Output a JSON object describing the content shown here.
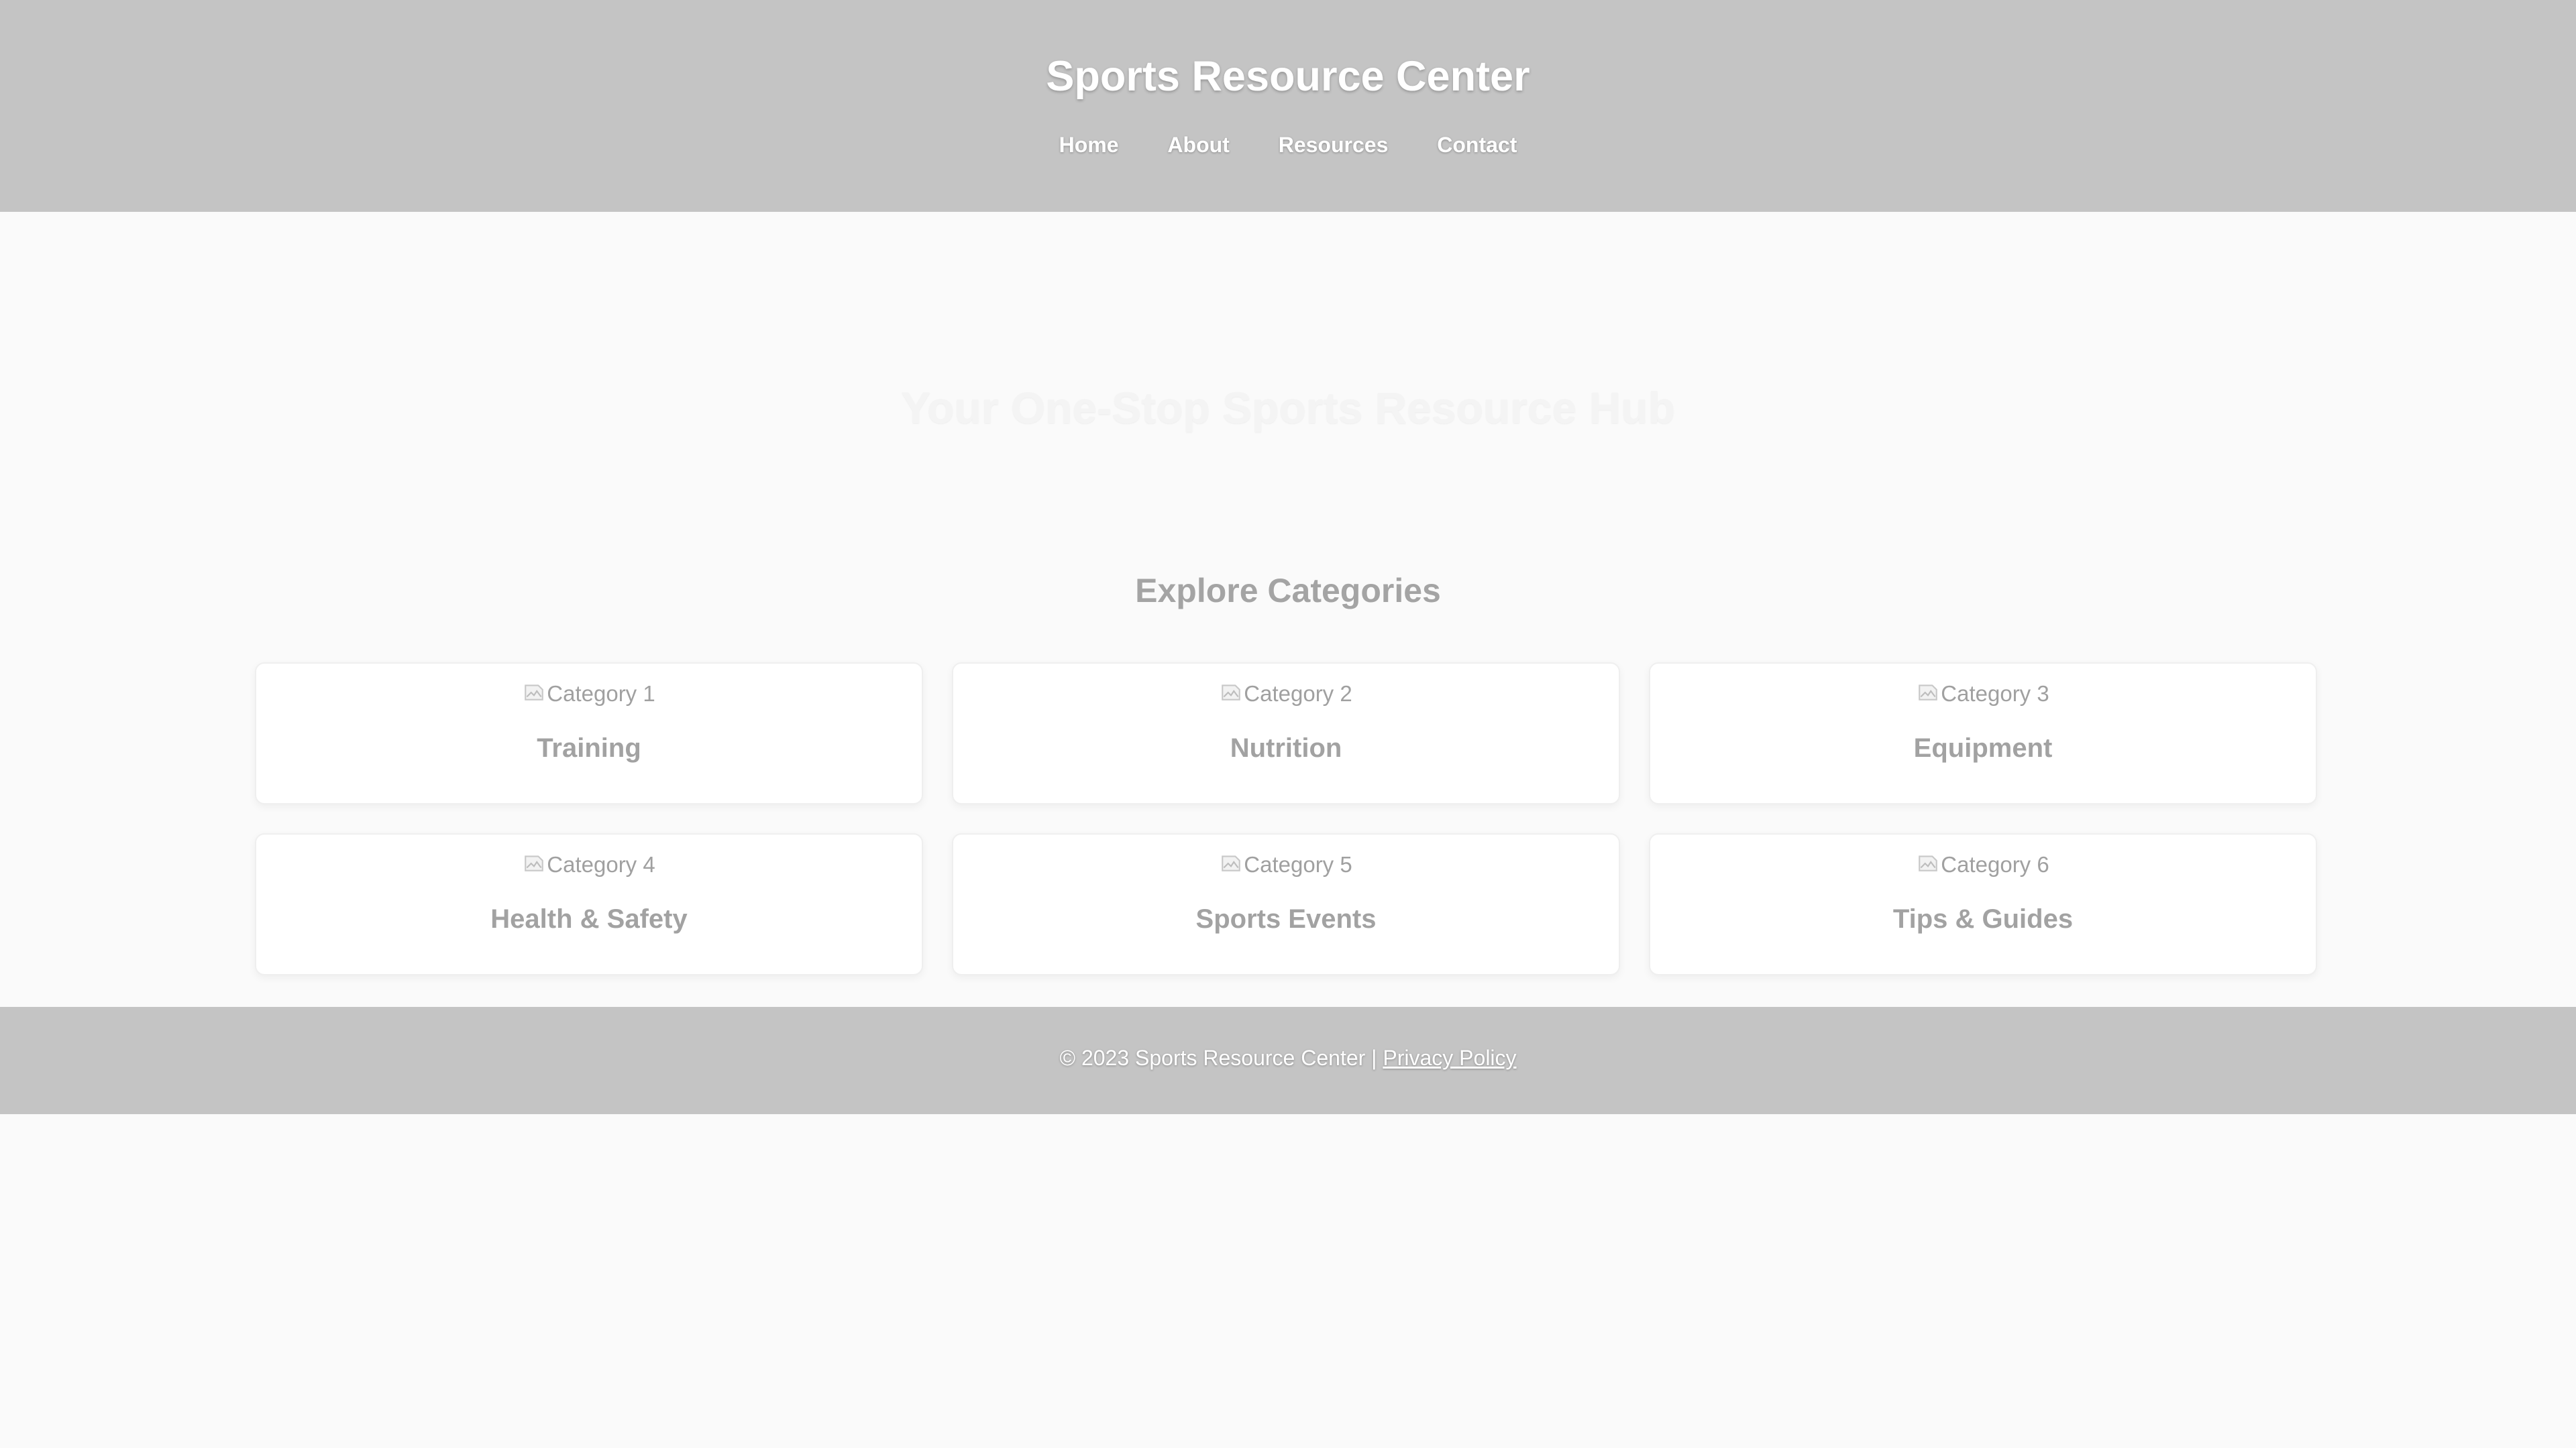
{
  "header": {
    "title": "Sports Resource Center",
    "nav": [
      "Home",
      "About",
      "Resources",
      "Contact"
    ]
  },
  "hero": {
    "tagline": "Your One-Stop Sports Resource Hub"
  },
  "categories": {
    "title": "Explore Categories",
    "items": [
      {
        "image_alt": "Category 1",
        "name": "Training"
      },
      {
        "image_alt": "Category 2",
        "name": "Nutrition"
      },
      {
        "image_alt": "Category 3",
        "name": "Equipment"
      },
      {
        "image_alt": "Category 4",
        "name": "Health & Safety"
      },
      {
        "image_alt": "Category 5",
        "name": "Sports Events"
      },
      {
        "image_alt": "Category 6",
        "name": "Tips & Guides"
      }
    ]
  },
  "footer": {
    "copyright": "© 2023 Sports Resource Center | ",
    "privacy_link": "Privacy Policy"
  },
  "colors": {
    "header_bg": "#c4c4c4",
    "page_bg": "#fafafa",
    "card_bg": "#ffffff"
  },
  "icons": {
    "card_image": "broken-image-icon"
  }
}
